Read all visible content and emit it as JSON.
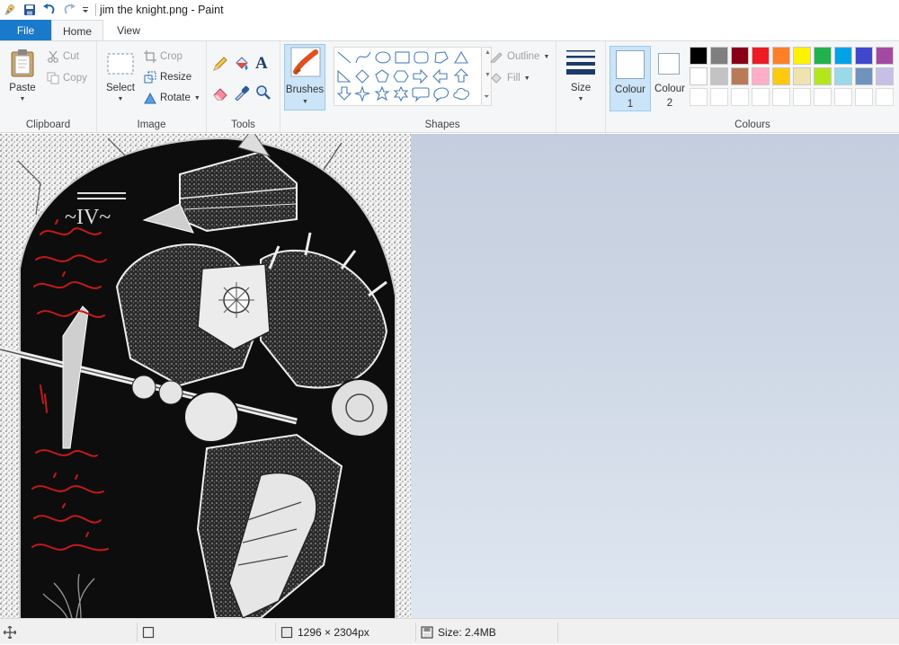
{
  "window": {
    "title": "jim the knight.png - Paint"
  },
  "tabs": {
    "file": "File",
    "home": "Home",
    "view": "View"
  },
  "clipboard": {
    "paste": "Paste",
    "cut": "Cut",
    "copy": "Copy",
    "label": "Clipboard"
  },
  "image": {
    "select": "Select",
    "crop": "Crop",
    "resize": "Resize",
    "rotate": "Rotate",
    "label": "Image"
  },
  "tools": {
    "label": "Tools"
  },
  "brushes": {
    "label": "Brushes"
  },
  "shapes": {
    "outline": "Outline",
    "fill": "Fill",
    "label": "Shapes"
  },
  "size": {
    "label": "Size"
  },
  "colours": {
    "colour1": "Colour",
    "colour1_num": "1",
    "colour2": "Colour",
    "colour2_num": "2",
    "label": "Colours",
    "palette_row1": [
      "#000000",
      "#7f7f7f",
      "#880015",
      "#ed1c24",
      "#ff7f27",
      "#fff200",
      "#22b14c",
      "#00a2e8",
      "#3f48cc",
      "#a349a4"
    ],
    "palette_row2": [
      "#ffffff",
      "#c3c3c3",
      "#b97a57",
      "#ffaec9",
      "#ffc90e",
      "#efe4b0",
      "#b5e61d",
      "#99d9ea",
      "#7092be",
      "#c8bfe7"
    ]
  },
  "canvas": {
    "roman_numeral": "~IV~"
  },
  "status": {
    "dimensions": "1296 × 2304px",
    "size": "Size: 2.4MB"
  }
}
